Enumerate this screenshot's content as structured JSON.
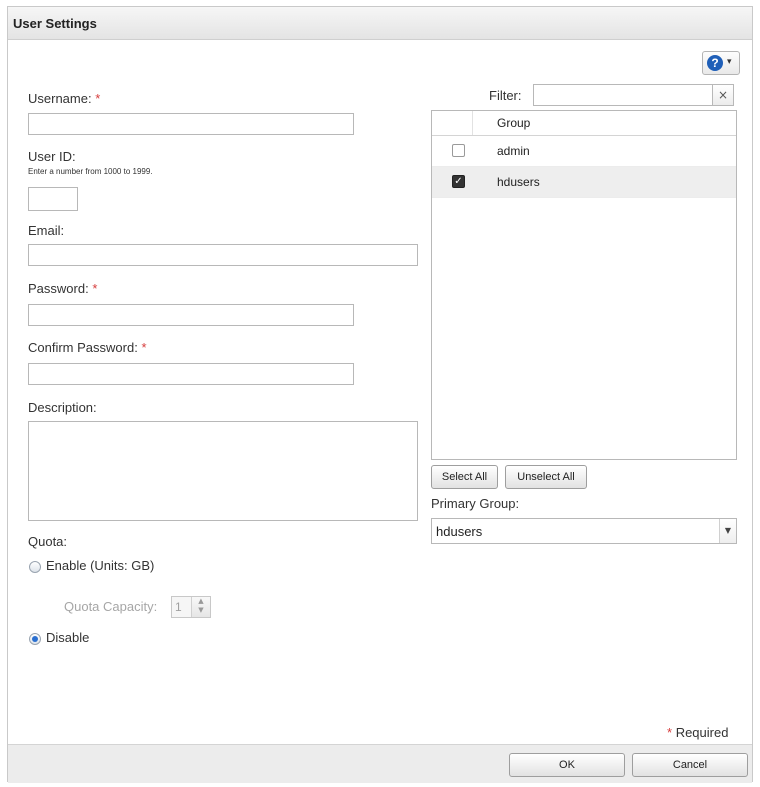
{
  "window": {
    "title": "User Settings"
  },
  "help": {
    "icon": "question-icon",
    "dropdown": "▾"
  },
  "form": {
    "username_label": "Username:",
    "user_id_label": "User ID:",
    "user_id_hint": "Enter a number from 1000 to 1999.",
    "email_label": "Email:",
    "password_label": "Password:",
    "confirm_password_label": "Confirm Password:",
    "description_label": "Description:",
    "required_mark": "*",
    "username_value": "",
    "user_id_value": "",
    "email_value": "",
    "password_value": "",
    "confirm_password_value": "",
    "description_value": ""
  },
  "quota": {
    "label": "Quota:",
    "enable_label": "Enable (Units: GB)",
    "capacity_label": "Quota Capacity:",
    "capacity_value": "1",
    "disable_label": "Disable",
    "selected": "Disable"
  },
  "filter": {
    "label": "Filter:",
    "value": "",
    "clear": "×"
  },
  "groups": {
    "column_header": "Group",
    "rows": [
      {
        "name": "admin",
        "checked": false
      },
      {
        "name": "hdusers",
        "checked": true
      }
    ]
  },
  "buttons": {
    "select_all": "Select All",
    "unselect_all": "Unselect All",
    "ok": "OK",
    "cancel": "Cancel"
  },
  "primary_group": {
    "label": "Primary Group:",
    "value": "hdusers"
  },
  "footer": {
    "required_note": "Required"
  },
  "colors": {
    "required": "#d63b3b",
    "accent": "#1f5fb8"
  }
}
